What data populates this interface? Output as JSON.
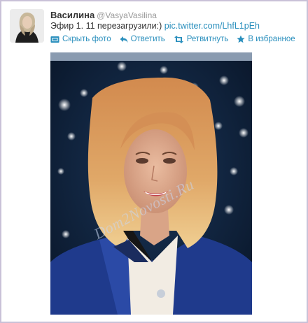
{
  "tweet": {
    "display_name": "Василина",
    "handle": "@VasyaVasilina",
    "text": "Эфир 1. 11 перезагрузили:)",
    "link": "pic.twitter.com/LhfL1pEh"
  },
  "actions": [
    {
      "label": "Скрыть фото",
      "icon": "photo-icon"
    },
    {
      "label": "Ответить",
      "icon": "reply-icon"
    },
    {
      "label": "Ретвитнуть",
      "icon": "retweet-icon"
    },
    {
      "label": "В избранное",
      "icon": "star-icon"
    }
  ],
  "photo": {
    "watermark": "Dom2Novosti.Ru"
  },
  "colors": {
    "link": "#2a8fbd",
    "frame_border": "#c9c1d8",
    "name": "#333333",
    "handle": "#999999"
  }
}
